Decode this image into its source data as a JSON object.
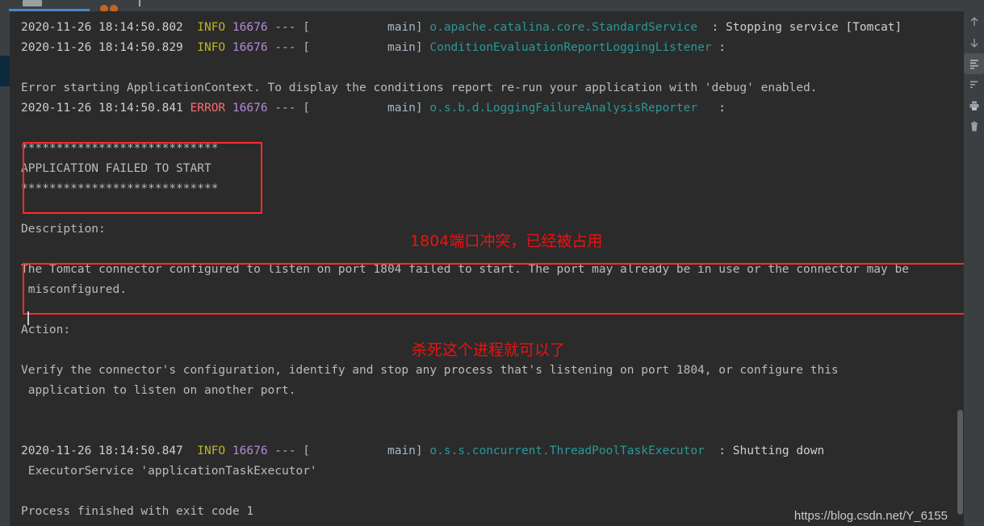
{
  "window": {
    "title": "Run console",
    "watermark": "https://blog.csdn.net/Y_6155"
  },
  "toolbar": {
    "tab_label": "",
    "icons": [
      "run-tab-indicator",
      "stop-chip-icon",
      "coffee-beans-icon",
      "divider-icon"
    ]
  },
  "rail": {
    "items": [
      {
        "name": "scroll-up-icon",
        "tooltip": "Up the Stack Trace"
      },
      {
        "name": "scroll-down-icon",
        "tooltip": "Down the Stack Trace"
      },
      {
        "name": "soft-wrap-icon",
        "tooltip": "Soft-Wrap"
      },
      {
        "name": "filter-icon",
        "tooltip": "Filter"
      },
      {
        "name": "print-icon",
        "tooltip": "Print"
      },
      {
        "name": "trash-icon",
        "tooltip": "Clear All"
      }
    ]
  },
  "console": {
    "lines": [
      {
        "id": "log-stopping-service",
        "segments": [
          {
            "cls": "c-ts",
            "text": "2020-11-26 18:14:50.802 "
          },
          {
            "cls": "c-info",
            "text": " INFO"
          },
          {
            "cls": "c-pid",
            "text": " 16676"
          },
          {
            "cls": "c-dash",
            "text": " --- ["
          },
          {
            "cls": "c-thread",
            "text": "           main] "
          },
          {
            "cls": "c-class",
            "text": "o.apache.catalina.core.StandardService"
          },
          {
            "cls": "c-msg",
            "text": "  : Stopping service [Tomcat]"
          }
        ]
      },
      {
        "id": "log-condition-eval",
        "segments": [
          {
            "cls": "c-ts",
            "text": "2020-11-26 18:14:50.829 "
          },
          {
            "cls": "c-info",
            "text": " INFO"
          },
          {
            "cls": "c-pid",
            "text": " 16676"
          },
          {
            "cls": "c-dash",
            "text": " --- ["
          },
          {
            "cls": "c-thread",
            "text": "           main] "
          },
          {
            "cls": "c-class",
            "text": "ConditionEvaluationReportLoggingListener"
          },
          {
            "cls": "c-msg",
            "text": " :"
          }
        ]
      },
      {
        "id": "spacer-1",
        "segments": [
          {
            "cls": "c-plain",
            "text": ""
          }
        ]
      },
      {
        "id": "log-error-starting-context",
        "segments": [
          {
            "cls": "c-plain",
            "text": "Error starting ApplicationContext. To display the conditions report re-run your application with 'debug' enabled."
          }
        ]
      },
      {
        "id": "log-failure-analysis-reporter",
        "segments": [
          {
            "cls": "c-ts",
            "text": "2020-11-26 18:14:50.841 "
          },
          {
            "cls": "c-error",
            "text": "ERROR"
          },
          {
            "cls": "c-pid",
            "text": " 16676"
          },
          {
            "cls": "c-dash",
            "text": " --- ["
          },
          {
            "cls": "c-thread",
            "text": "           main] "
          },
          {
            "cls": "c-class",
            "text": "o.s.b.d.LoggingFailureAnalysisReporter"
          },
          {
            "cls": "c-msg",
            "text": "   :"
          }
        ]
      },
      {
        "id": "spacer-2",
        "segments": [
          {
            "cls": "c-plain",
            "text": ""
          }
        ]
      },
      {
        "id": "banner-top",
        "segments": [
          {
            "cls": "c-plain",
            "text": "****************************"
          }
        ]
      },
      {
        "id": "banner-title",
        "segments": [
          {
            "cls": "c-plain",
            "text": "APPLICATION FAILED TO START"
          }
        ]
      },
      {
        "id": "banner-bottom",
        "segments": [
          {
            "cls": "c-plain",
            "text": "****************************"
          }
        ]
      },
      {
        "id": "spacer-3",
        "segments": [
          {
            "cls": "c-plain",
            "text": ""
          }
        ]
      },
      {
        "id": "label-description",
        "segments": [
          {
            "cls": "c-plain",
            "text": "Description:"
          }
        ]
      },
      {
        "id": "spacer-4",
        "segments": [
          {
            "cls": "c-plain",
            "text": ""
          }
        ]
      },
      {
        "id": "desc-line-1",
        "segments": [
          {
            "cls": "c-plain",
            "text": "The Tomcat connector configured to listen on port 1804 failed to start. The port may already be in use or the connector may be"
          }
        ]
      },
      {
        "id": "desc-line-2",
        "segments": [
          {
            "cls": "c-plain",
            "text": " misconfigured."
          }
        ]
      },
      {
        "id": "spacer-5",
        "segments": [
          {
            "cls": "c-plain",
            "text": ""
          }
        ]
      },
      {
        "id": "label-action",
        "segments": [
          {
            "cls": "c-plain",
            "text": "Action:"
          }
        ]
      },
      {
        "id": "spacer-6",
        "segments": [
          {
            "cls": "c-plain",
            "text": ""
          }
        ]
      },
      {
        "id": "action-line-1",
        "segments": [
          {
            "cls": "c-plain",
            "text": "Verify the connector's configuration, identify and stop any process that's listening on port 1804, or configure this"
          }
        ]
      },
      {
        "id": "action-line-2",
        "segments": [
          {
            "cls": "c-plain",
            "text": " application to listen on another port."
          }
        ]
      },
      {
        "id": "spacer-7",
        "segments": [
          {
            "cls": "c-plain",
            "text": ""
          }
        ]
      },
      {
        "id": "spacer-8",
        "segments": [
          {
            "cls": "c-plain",
            "text": ""
          }
        ]
      },
      {
        "id": "log-threadpool-shutdown",
        "segments": [
          {
            "cls": "c-ts",
            "text": "2020-11-26 18:14:50.847 "
          },
          {
            "cls": "c-info",
            "text": " INFO"
          },
          {
            "cls": "c-pid",
            "text": " 16676"
          },
          {
            "cls": "c-dash",
            "text": " --- ["
          },
          {
            "cls": "c-thread",
            "text": "           main] "
          },
          {
            "cls": "c-class",
            "text": "o.s.s.concurrent.ThreadPoolTaskExecutor"
          },
          {
            "cls": "c-msg",
            "text": "  : Shutting down"
          }
        ]
      },
      {
        "id": "log-executor-service",
        "segments": [
          {
            "cls": "c-plain",
            "text": " ExecutorService 'applicationTaskExecutor'"
          }
        ]
      },
      {
        "id": "spacer-9",
        "segments": [
          {
            "cls": "c-plain",
            "text": ""
          }
        ]
      },
      {
        "id": "log-process-finished",
        "segments": [
          {
            "cls": "c-plain",
            "text": "Process finished with exit code 1"
          }
        ]
      }
    ]
  },
  "annotations": {
    "boxes": [
      {
        "id": "box-failed",
        "name": "highlight-box-application-failed"
      },
      {
        "id": "box-tomcat",
        "name": "highlight-box-tomcat-description"
      }
    ],
    "port_conflict": "1804端口冲突，已经被占用",
    "kill_process": "杀死这个进程就可以了",
    "color": "#ee1111"
  }
}
